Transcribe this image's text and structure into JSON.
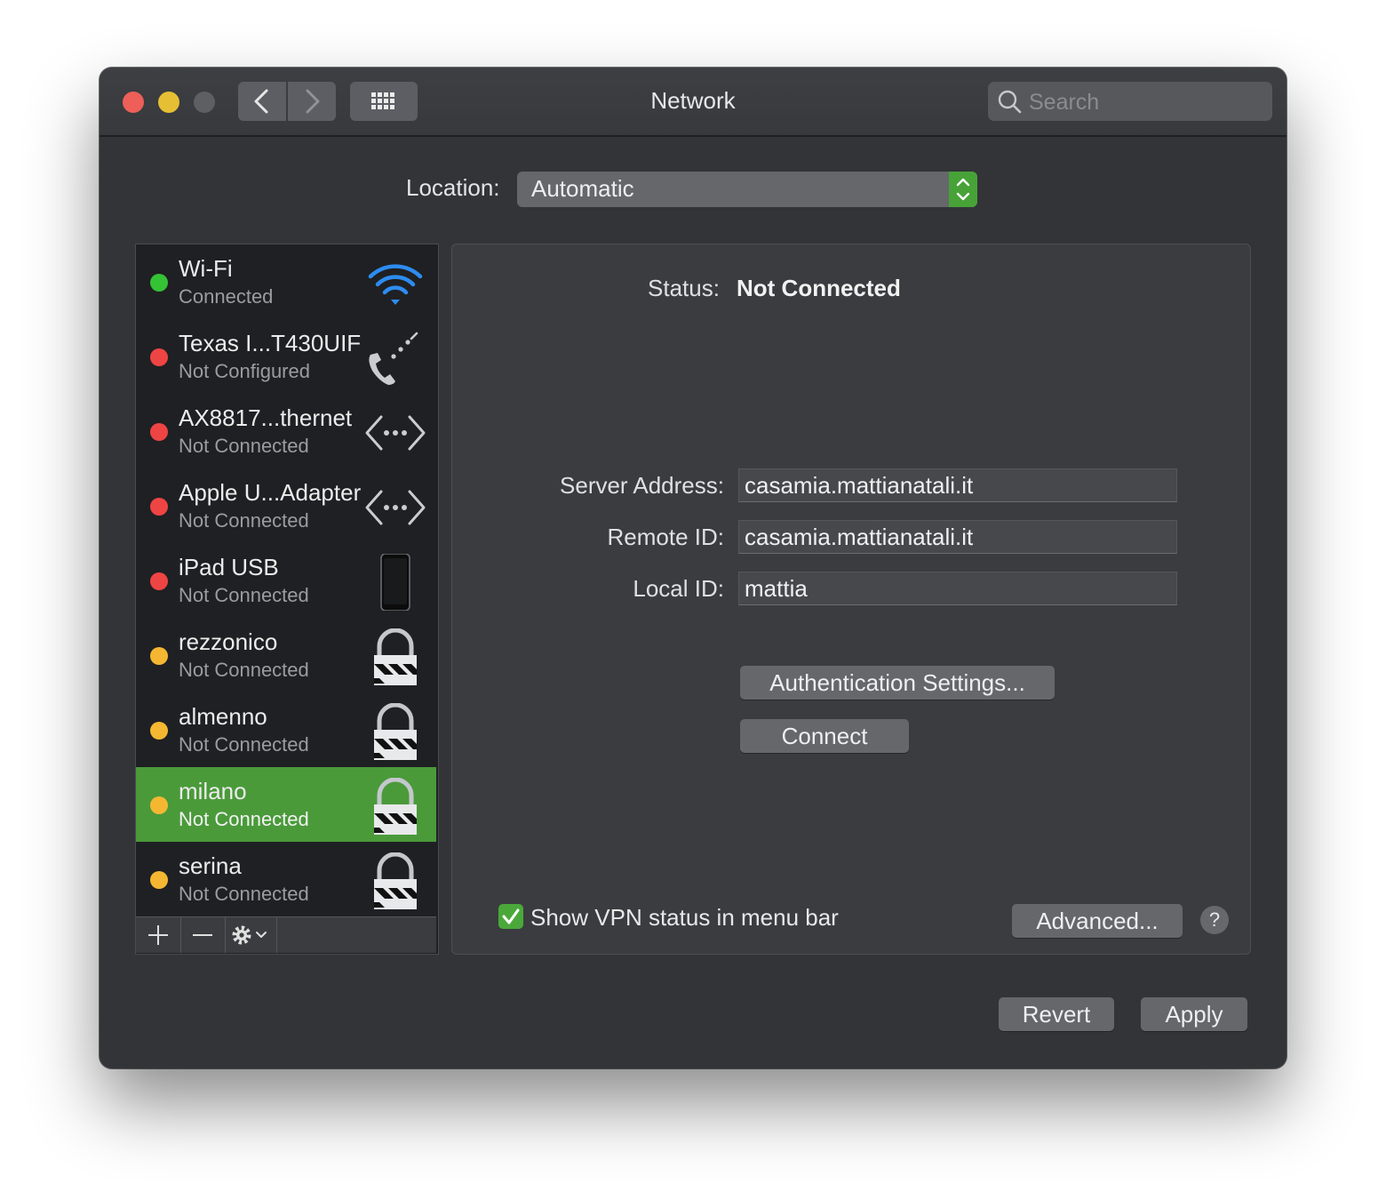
{
  "window": {
    "title": "Network",
    "search_placeholder": "Search"
  },
  "location": {
    "label": "Location:",
    "value": "Automatic"
  },
  "services": [
    {
      "name": "Wi-Fi",
      "status": "Connected",
      "dot_color": "#35c235",
      "icon": "wifi-icon"
    },
    {
      "name": "Texas I...T430UIF",
      "status": "Not Configured",
      "dot_color": "#ef4444",
      "icon": "phone-modem-icon"
    },
    {
      "name": "AX8817...thernet",
      "status": "Not Connected",
      "dot_color": "#ef4444",
      "icon": "ethernet-icon"
    },
    {
      "name": "Apple U...Adapter",
      "status": "Not Connected",
      "dot_color": "#ef4444",
      "icon": "ethernet-icon"
    },
    {
      "name": "iPad USB",
      "status": "Not Connected",
      "dot_color": "#ef4444",
      "icon": "ipad-icon"
    },
    {
      "name": "rezzonico",
      "status": "Not Connected",
      "dot_color": "#f5b731",
      "icon": "vpn-lock-icon"
    },
    {
      "name": "almenno",
      "status": "Not Connected",
      "dot_color": "#f5b731",
      "icon": "vpn-lock-icon"
    },
    {
      "name": "milano",
      "status": "Not Connected",
      "dot_color": "#f5b731",
      "icon": "vpn-lock-icon",
      "selected": true
    },
    {
      "name": "serina",
      "status": "Not Connected",
      "dot_color": "#f5b731",
      "icon": "vpn-lock-icon"
    }
  ],
  "detail": {
    "status_label": "Status:",
    "status_value": "Not Connected",
    "server_address_label": "Server Address:",
    "server_address": "casamia.mattianatali.it",
    "remote_id_label": "Remote ID:",
    "remote_id": "casamia.mattianatali.it",
    "local_id_label": "Local ID:",
    "local_id": "mattia",
    "auth_button": "Authentication Settings...",
    "connect_button": "Connect",
    "show_vpn_label": "Show VPN status in menu bar",
    "show_vpn_checked": true,
    "advanced_button": "Advanced...",
    "help_button": "?"
  },
  "footer": {
    "revert_button": "Revert",
    "apply_button": "Apply"
  },
  "colors": {
    "accent_green": "#4a9a3a",
    "window_bg": "#323438"
  }
}
